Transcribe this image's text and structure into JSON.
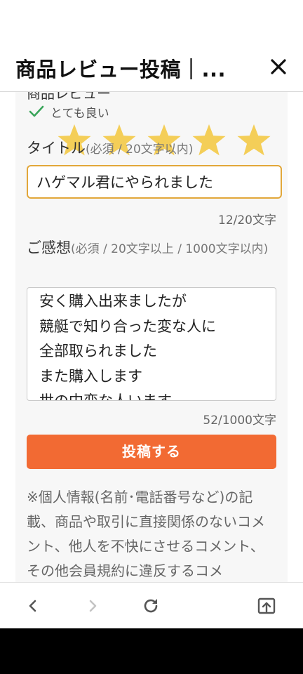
{
  "header": {
    "title": "商品レビュー投稿｜..."
  },
  "form": {
    "cut_label": "商品レビュー",
    "rating_text": "とても良い",
    "star_count": 5,
    "rating_value": 5,
    "title_label": "タイトル",
    "title_requirement": "(必須 / 20文字以内)",
    "title_value": "ハゲマル君にやられました",
    "title_counter": "12/20文字",
    "comment_label": "ご感想",
    "comment_requirement": "(必須 / 20文字以上 / 1000文字以内)",
    "comment_lines": [
      "安く購入出来ましたが",
      "競艇で知り合った変な人に",
      "全部取られました",
      "また購入します",
      "世の中変な人います"
    ],
    "comment_counter": "52/1000文字",
    "submit_label": "投稿する",
    "notice": "※個人情報(名前･電話番号など)の記載、商品や取引に直接関係のないコメント、他人を不快にさせるコメント、その他会員規約に違反するコメ"
  },
  "colors": {
    "accent": "#f26a33",
    "star": "#f4c842",
    "input_border": "#e2a73a",
    "check": "#3aa55a"
  },
  "icons": {
    "close": "close-icon",
    "check": "check-icon",
    "back": "chevron-left-icon",
    "forward": "chevron-right-icon",
    "reload": "reload-icon",
    "share": "share-icon"
  }
}
